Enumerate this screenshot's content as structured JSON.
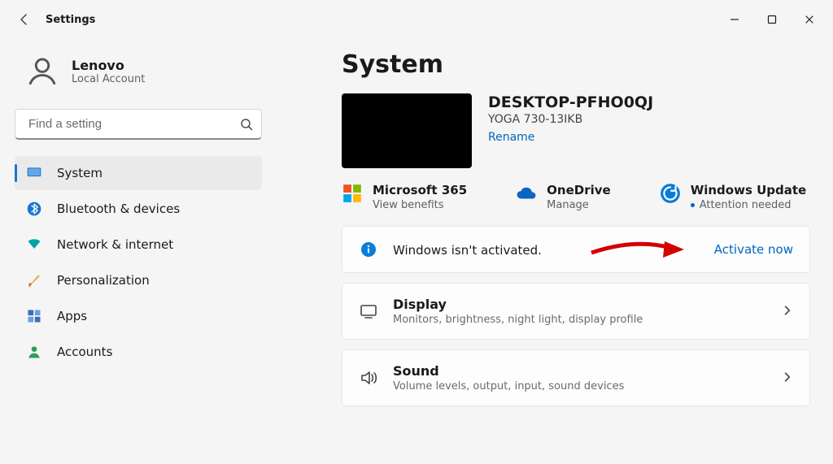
{
  "app_title": "Settings",
  "account": {
    "name": "Lenovo",
    "type": "Local Account"
  },
  "search": {
    "placeholder": "Find a setting"
  },
  "nav": {
    "system": "System",
    "bluetooth": "Bluetooth & devices",
    "network": "Network & internet",
    "personalization": "Personalization",
    "apps": "Apps",
    "accounts": "Accounts"
  },
  "page": {
    "heading": "System",
    "device_name": "DESKTOP-PFHO0QJ",
    "device_model": "YOGA 730-13IKB",
    "rename": "Rename"
  },
  "tiles": {
    "m365": {
      "title": "Microsoft 365",
      "sub": "View benefits"
    },
    "onedrive": {
      "title": "OneDrive",
      "sub": "Manage"
    },
    "update": {
      "title": "Windows Update",
      "sub": "Attention needed"
    }
  },
  "activation": {
    "message": "Windows isn't activated.",
    "action": "Activate now"
  },
  "cards": {
    "display": {
      "title": "Display",
      "sub": "Monitors, brightness, night light, display profile"
    },
    "sound": {
      "title": "Sound",
      "sub": "Volume levels, output, input, sound devices"
    }
  }
}
